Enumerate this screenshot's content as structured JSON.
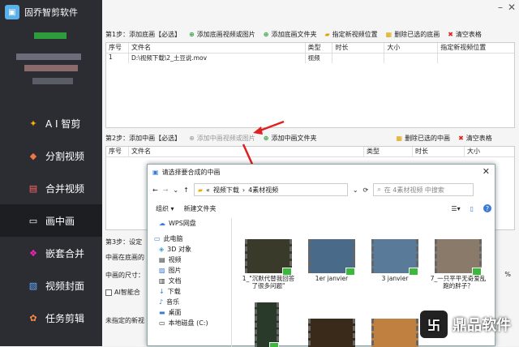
{
  "app": {
    "title": "固乔智剪软件"
  },
  "nav": [
    {
      "label": "A I 智剪",
      "icon": "ai-icon"
    },
    {
      "label": "分割视频",
      "icon": "split-icon"
    },
    {
      "label": "合并视频",
      "icon": "merge-icon"
    },
    {
      "label": "画中画",
      "icon": "pip-icon"
    },
    {
      "label": "嵌套合并",
      "icon": "nest-icon"
    },
    {
      "label": "视频封面",
      "icon": "cover-icon"
    },
    {
      "label": "任务剪辑",
      "icon": "task-icon"
    }
  ],
  "step1": {
    "label": "第1步：添加底画【必选】",
    "add_video": "添加底画视频或图片",
    "add_folder": "添加底画文件夹",
    "set_pos": "指定新视频位置",
    "delete": "删除已选的底画",
    "clear": "清空表格"
  },
  "table1": {
    "headers": [
      "序号",
      "文件名",
      "类型",
      "时长",
      "大小",
      "指定新视频位置"
    ],
    "rows": [
      {
        "idx": "1",
        "name": "D:\\视频下载\\2_土豆说.mov",
        "type": "视频",
        "dur": "",
        "size": "",
        "pos": ""
      }
    ]
  },
  "step2": {
    "label": "第2步：添加中画【必选】",
    "add_video": "添加中画视频或图片",
    "add_folder": "添加中画文件夹",
    "delete": "删除已选的中画",
    "clear": "清空表格"
  },
  "table2": {
    "headers": [
      "序号",
      "文件名",
      "类型",
      "时长",
      "大小"
    ]
  },
  "step3": {
    "label": "第3步：设定",
    "line1": "中画在底画的",
    "line2": "中画的尺寸：",
    "line3": "AI智能合",
    "line4": "未指定的新视",
    "pct": "%"
  },
  "dialog": {
    "title": "请选择要合成的中画",
    "breadcrumb": [
      "«",
      "视频下载",
      "4素材视频"
    ],
    "search_placeholder": "在 4素材视频 中搜索",
    "organize": "组织 ▾",
    "new_folder": "新建文件夹",
    "navpane": [
      "WPS网盘",
      "此电脑",
      "3D 对象",
      "视频",
      "图片",
      "文档",
      "下载",
      "音乐",
      "桌面",
      "本地磁盘 (C:)"
    ],
    "files": [
      {
        "name": "1_\"沉默代替我回答了很多问题\""
      },
      {
        "name": "1er janvier"
      },
      {
        "name": "3 janvier"
      },
      {
        "name": "7_一只平平无奇爱乱跑的胖子？"
      },
      {
        "name": ""
      },
      {
        "name": ""
      },
      {
        "name": ""
      }
    ]
  },
  "watermark": {
    "text": "鼎品软件"
  }
}
